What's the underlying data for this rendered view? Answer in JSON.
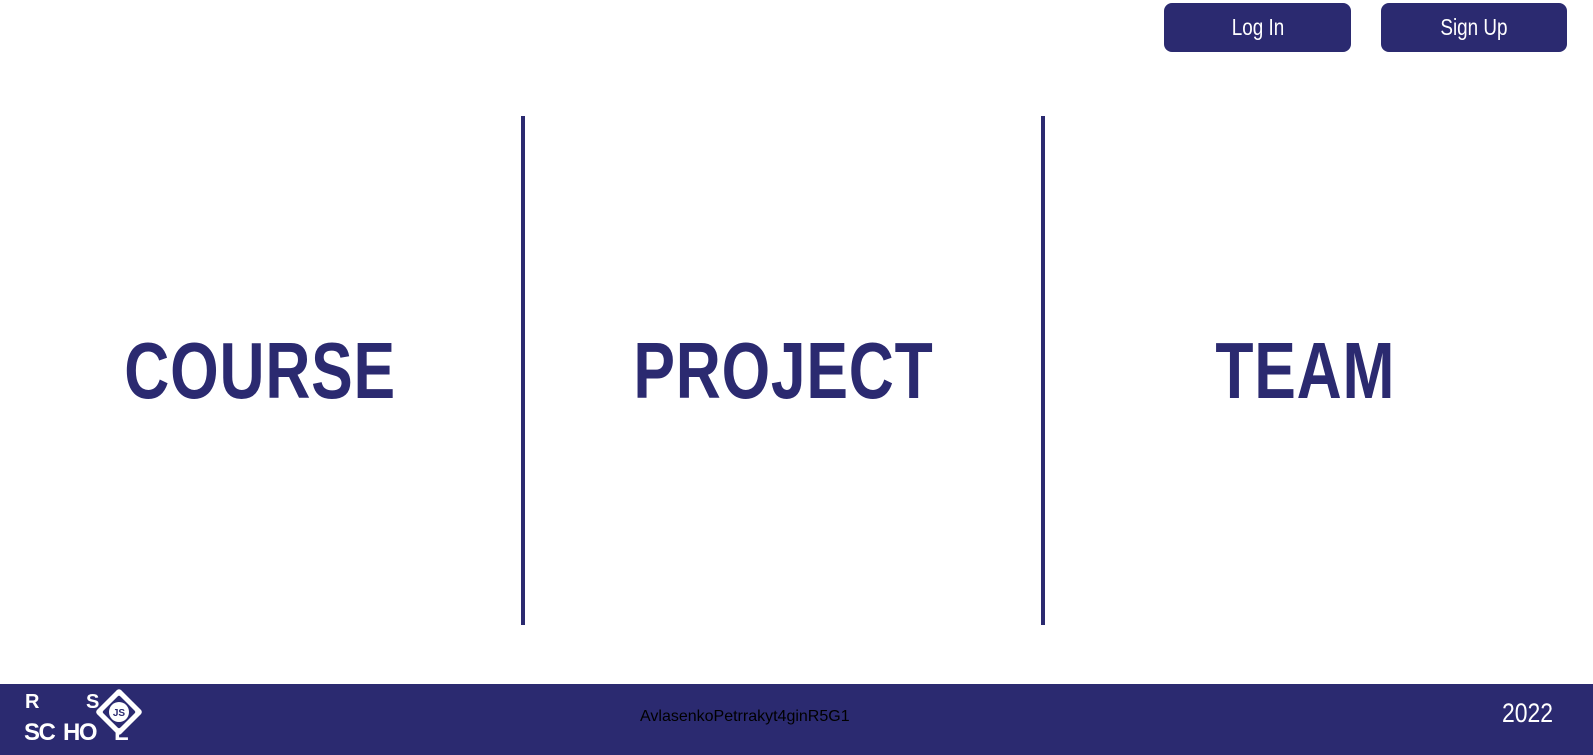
{
  "header": {
    "login_label": "Log In",
    "signup_label": "Sign Up"
  },
  "sections": {
    "course": "COURSE",
    "project": "PROJECT",
    "team": "TEAM"
  },
  "footer": {
    "logo_icon": "rs-school-js-logo",
    "logo_text_line1": "R S",
    "logo_text_line2": "SCHOOL",
    "logo_badge": "JS",
    "links": [
      "AvlasenkoPetr",
      "rakyt4gin",
      "R5G1"
    ],
    "year": "2022"
  },
  "colors": {
    "primary": "#2b2a70",
    "background": "#ffffff",
    "text_on_primary": "#ffffff"
  }
}
